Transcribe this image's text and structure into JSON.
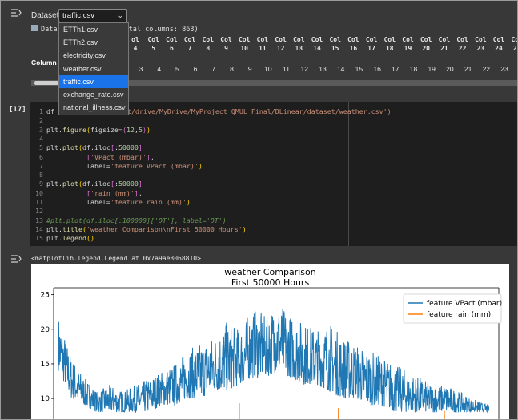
{
  "dataset_widget": {
    "label": "Dataset:",
    "selected": "traffic.csv",
    "options": [
      "ETTh1.csv",
      "ETTh2.csv",
      "electricity.csv",
      "weather.csv",
      "traffic.csv",
      "exchange_rate.csv",
      "national_illness.csv"
    ],
    "selected_index": 4
  },
  "info": {
    "prefix": "Data",
    "suffix": "otal columns: 863)"
  },
  "table": {
    "header_top": [
      "ol",
      "Col",
      "Col",
      "Col",
      "Col",
      "Col",
      "Col",
      "Col",
      "Col",
      "Col",
      "Col",
      "Col",
      "Col",
      "Col",
      "Col",
      "Col",
      "Col",
      "Col",
      "Col",
      "Col",
      "Col",
      "Col",
      "Col"
    ],
    "header_bottom": [
      "4",
      "5",
      "6",
      "7",
      "8",
      "9",
      "10",
      "11",
      "12",
      "13",
      "14",
      "15",
      "16",
      "17",
      "18",
      "19",
      "20",
      "21",
      "22",
      "23",
      "24",
      "25"
    ],
    "row_label": "Column Names",
    "row_values": [
      "3",
      "4",
      "5",
      "6",
      "7",
      "8",
      "9",
      "10",
      "11",
      "12",
      "13",
      "14",
      "15",
      "16",
      "17",
      "18",
      "19",
      "20",
      "21",
      "22",
      "23"
    ]
  },
  "code_cell": {
    "number": "[17]",
    "path_visible": "ntent/drive/MyDrive/MyProject_QMUL_Final/DLinear/dataset/weather.csv')",
    "lines": [
      {
        "n": "1",
        "text": "df"
      },
      {
        "n": "2",
        "text": ""
      },
      {
        "n": "3",
        "text": "plt.figure(figsize=(12,5))"
      },
      {
        "n": "4",
        "text": ""
      },
      {
        "n": "5",
        "text": "plt.plot(df.iloc[:50000]"
      },
      {
        "n": "6",
        "text": "['VPact (mbar)'],"
      },
      {
        "n": "7",
        "text": "label='feature VPact (mbar)')"
      },
      {
        "n": "8",
        "text": ""
      },
      {
        "n": "9",
        "text": "plt.plot(df.iloc[:50000]"
      },
      {
        "n": "10",
        "text": "['rain (mm)'],"
      },
      {
        "n": "11",
        "text": "label='feature rain (mm)')"
      },
      {
        "n": "12",
        "text": ""
      },
      {
        "n": "13",
        "text": "#plt.plot(df.iloc[:100000]['OT'], label='OT')"
      },
      {
        "n": "14",
        "text": "plt.title('weather Comparison\\nFirst 50000 Hours')"
      },
      {
        "n": "15",
        "text": "plt.legend()"
      }
    ]
  },
  "output": {
    "repr": "<matplotlib.legend.Legend at 0x7a9ae8068810>"
  },
  "chart_data": {
    "type": "line",
    "title": "weather Comparison\nFirst 50000 Hours",
    "title_line1": "weather Comparison",
    "title_line2": "First 50000 Hours",
    "xlabel": "",
    "ylabel": "",
    "yticks": [
      10,
      15,
      20,
      25
    ],
    "ylim_visible": [
      7,
      26
    ],
    "grid": false,
    "legend_placement": "top-right",
    "series": [
      {
        "name": "feature VPact (mbar)",
        "color": "#1f77b4",
        "envelope": [
          [
            0,
            14,
            22
          ],
          [
            1500,
            10,
            16
          ],
          [
            3000,
            9,
            13
          ],
          [
            4500,
            8,
            11
          ],
          [
            6000,
            8,
            12
          ],
          [
            7500,
            8,
            11
          ],
          [
            9000,
            8,
            12
          ],
          [
            10500,
            8,
            13
          ],
          [
            12000,
            9,
            14
          ],
          [
            13500,
            9,
            15
          ],
          [
            15000,
            10,
            17
          ],
          [
            16500,
            10,
            18
          ],
          [
            18000,
            11,
            19
          ],
          [
            19500,
            11,
            21
          ],
          [
            21000,
            12,
            20
          ],
          [
            22500,
            13,
            23
          ],
          [
            24000,
            13,
            22
          ],
          [
            25500,
            14,
            24
          ],
          [
            27000,
            13,
            22
          ],
          [
            28500,
            12,
            21
          ],
          [
            30000,
            12,
            20
          ],
          [
            31500,
            11,
            21
          ],
          [
            33000,
            10,
            19
          ],
          [
            34500,
            10,
            18
          ],
          [
            36000,
            9,
            17
          ],
          [
            37500,
            9,
            16
          ],
          [
            39000,
            8,
            15
          ],
          [
            40500,
            8,
            14
          ],
          [
            42000,
            8,
            13
          ],
          [
            43500,
            8,
            12
          ],
          [
            45000,
            8,
            12
          ],
          [
            46500,
            8,
            11
          ],
          [
            48000,
            8,
            10
          ],
          [
            50000,
            8,
            9
          ]
        ]
      },
      {
        "name": "feature rain (mm)",
        "color": "#ff7f0e",
        "spikes": [
          [
            21000,
            9.3
          ],
          [
            32500,
            8.6
          ],
          [
            44800,
            8.2
          ]
        ]
      }
    ]
  },
  "colors": {
    "accent": "#1a73e8",
    "editor_bg": "#1e1e1e",
    "cell_bg": "#383838"
  }
}
